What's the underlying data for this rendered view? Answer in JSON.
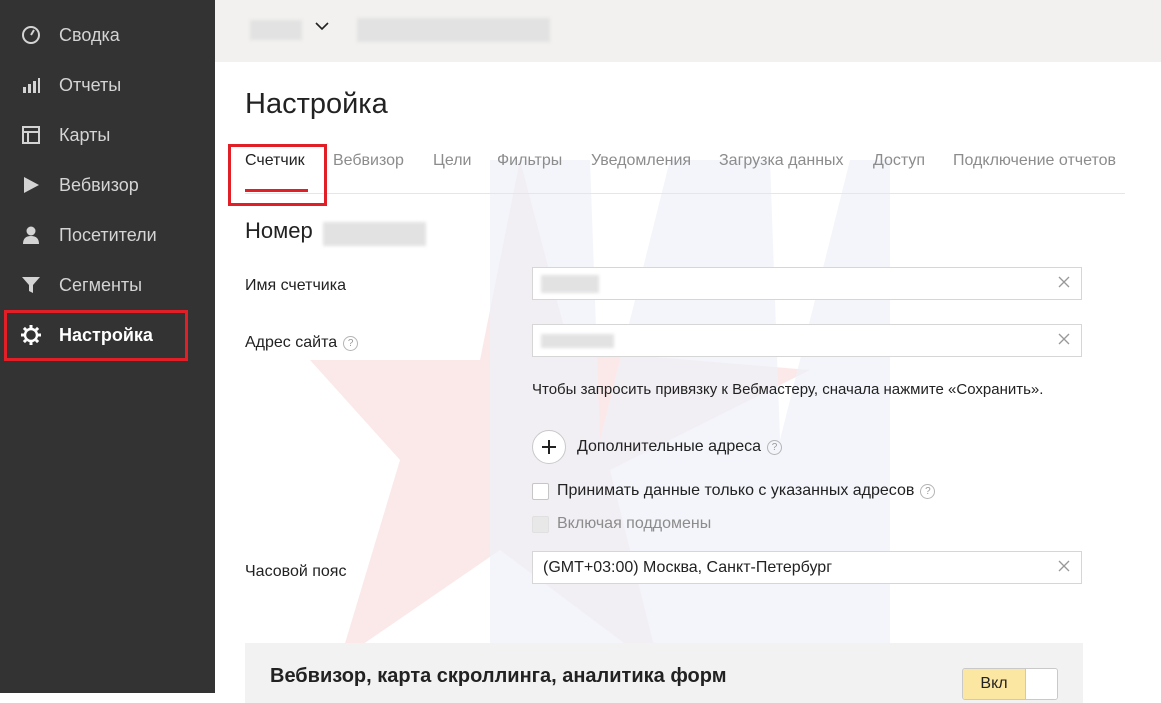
{
  "sidebar": {
    "items": [
      {
        "label": "Сводка",
        "icon": "speedometer-icon"
      },
      {
        "label": "Отчеты",
        "icon": "bar-chart-icon"
      },
      {
        "label": "Карты",
        "icon": "map-layout-icon"
      },
      {
        "label": "Вебвизор",
        "icon": "play-icon"
      },
      {
        "label": "Посетители",
        "icon": "person-icon"
      },
      {
        "label": "Сегменты",
        "icon": "filter-icon"
      },
      {
        "label": "Настройка",
        "icon": "gear-icon"
      }
    ],
    "active_index": 6
  },
  "page": {
    "title": "Настройка"
  },
  "tabs": [
    {
      "label": "Счетчик"
    },
    {
      "label": "Вебвизор"
    },
    {
      "label": "Цели"
    },
    {
      "label": "Фильтры"
    },
    {
      "label": "Уведомления"
    },
    {
      "label": "Загрузка данных"
    },
    {
      "label": "Доступ"
    },
    {
      "label": "Подключение отчетов"
    }
  ],
  "form": {
    "number_label": "Номер",
    "name_label": "Имя счетчика",
    "site_label": "Адрес сайта",
    "hint": "Чтобы запросить привязку к Вебмастеру, сначала нажмите «Сохранить».",
    "additional_addresses": "Дополнительные адреса",
    "only_listed_label": "Принимать данные только с указанных адресов",
    "subdomains_label": "Включая поддомены",
    "timezone_label": "Часовой пояс",
    "timezone_value": "(GMT+03:00) Москва, Санкт-Петербург"
  },
  "webvisor_panel": {
    "title": "Вебвизор, карта скроллинга, аналитика форм",
    "toggle_label": "Вкл"
  },
  "colors": {
    "sidebar_bg": "#333333",
    "accent_red": "#e01f26",
    "toggle_on": "#fbe6a2"
  }
}
